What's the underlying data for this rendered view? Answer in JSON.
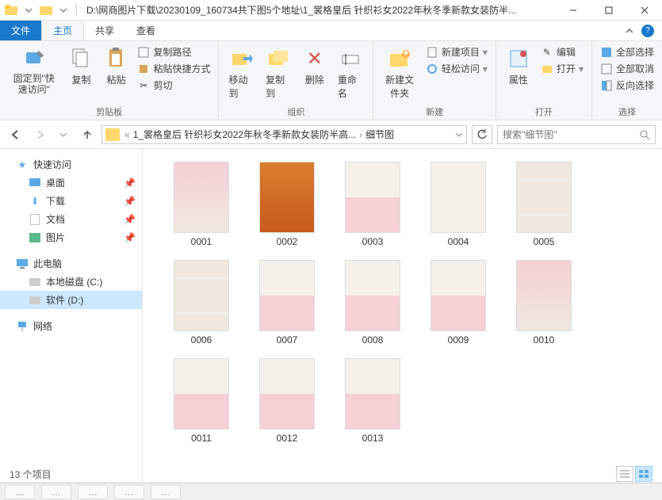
{
  "titlebar": {
    "path": "D:\\网商图片下载\\20230109_160734共下图5个地址\\1_裳格皇后 针织衫女2022年秋冬季新款女装防半..."
  },
  "tabs": {
    "file": "文件",
    "home": "主页",
    "share": "共享",
    "view": "查看"
  },
  "ribbon": {
    "pin": "固定到\"快速访问\"",
    "copy": "复制",
    "paste": "粘贴",
    "copypath": "复制路径",
    "pasteshortcut": "粘贴快捷方式",
    "cut": "剪切",
    "clipboard": "剪贴板",
    "moveto": "移动到",
    "copyto": "复制到",
    "delete": "删除",
    "rename": "重命名",
    "organize": "组织",
    "newfolder": "新建文件夹",
    "newitem": "新建项目",
    "easyaccess": "轻松访问",
    "new": "新建",
    "properties": "属性",
    "edit": "编辑",
    "open_btn": "打开",
    "open": "打开",
    "selectall": "全部选择",
    "selectnone": "全部取消",
    "invertsel": "反向选择",
    "select": "选择"
  },
  "address": {
    "crumb1": "1_裳格皇后 针织衫女2022年秋冬季新款女装防半高...",
    "crumb2": "细节图",
    "search_placeholder": "搜索\"细节图\""
  },
  "sidebar": {
    "quickaccess": "快速访问",
    "desktop": "桌面",
    "downloads": "下载",
    "documents": "文档",
    "pictures": "图片",
    "thispc": "此电脑",
    "localC": "本地磁盘 (C:)",
    "localD": "软件 (D:)",
    "network": "网络"
  },
  "files": [
    {
      "name": "0001",
      "style": "pink"
    },
    {
      "name": "0002",
      "style": "orange"
    },
    {
      "name": "0003",
      "style": "split"
    },
    {
      "name": "0004",
      "style": "white"
    },
    {
      "name": "0005",
      "style": "grid4"
    },
    {
      "name": "0006",
      "style": "grid4"
    },
    {
      "name": "0007",
      "style": "split"
    },
    {
      "name": "0008",
      "style": "split"
    },
    {
      "name": "0009",
      "style": "split"
    },
    {
      "name": "0010",
      "style": "pink"
    },
    {
      "name": "0011",
      "style": "split"
    },
    {
      "name": "0012",
      "style": "split"
    },
    {
      "name": "0013",
      "style": "split"
    }
  ],
  "status": {
    "count": "13 个项目"
  }
}
